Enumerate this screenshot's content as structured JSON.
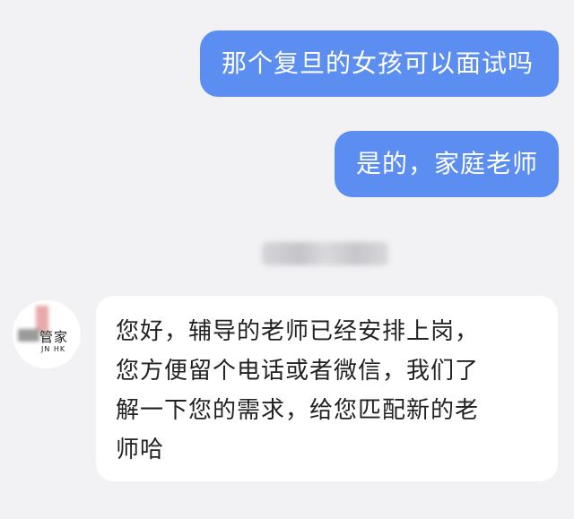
{
  "messages": [
    {
      "direction": "outgoing",
      "text": "那个复旦的女孩可以面试吗"
    },
    {
      "direction": "outgoing",
      "text": "是的，家庭老师"
    },
    {
      "direction": "incoming",
      "lines": [
        "您好，辅导的老师已经安排上岗，",
        "您方便留个电话或者微信，我们了",
        "解一下您的需求，给您匹配新的老",
        "师哈"
      ]
    }
  ],
  "contact": {
    "avatar_text": "管家",
    "avatar_subtext": "JN HK"
  },
  "colors": {
    "outgoing_bubble": "#5b8ef0",
    "incoming_bubble": "#ffffff",
    "background": "#f2f2f4"
  }
}
